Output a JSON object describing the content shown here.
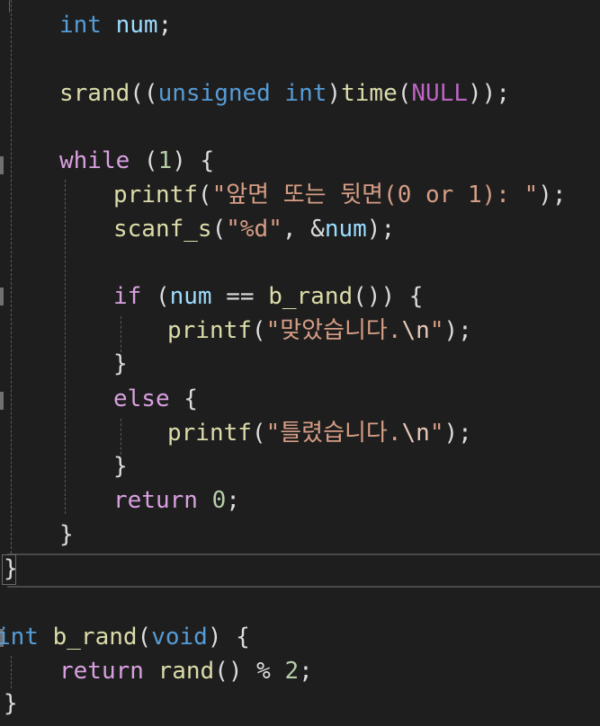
{
  "code": {
    "l1": {
      "t1": "int",
      "t2": "num",
      "t3": ";"
    },
    "l2": {
      "t1": "srand",
      "t2": "((",
      "t3": "unsigned",
      "t4": "int",
      "t5": ")",
      "t6": "time",
      "t7": "(",
      "t8": "NULL",
      "t9": "));"
    },
    "l3": {
      "t1": "while",
      "t2": " (",
      "t3": "1",
      "t4": ") {"
    },
    "l4": {
      "t1": "printf",
      "t2": "(",
      "t3": "\"앞면 또는 뒷면(0 or 1): \"",
      "t4": ");"
    },
    "l5": {
      "t1": "scanf_s",
      "t2": "(",
      "t3": "\"%d\"",
      "t4": ", &",
      "t5": "num",
      "t6": ");"
    },
    "l6": {
      "t1": "if",
      "t2": " (",
      "t3": "num",
      "t4": " == ",
      "t5": "b_rand",
      "t6": "()) {"
    },
    "l7": {
      "t1": "printf",
      "t2": "(",
      "t3": "\"맞았습니다.",
      "t4": "\\n",
      "t5": "\"",
      "t6": ");"
    },
    "l8": {
      "t1": "}"
    },
    "l9": {
      "t1": "else",
      "t2": " {"
    },
    "l10": {
      "t1": "printf",
      "t2": "(",
      "t3": "\"틀렸습니다.",
      "t4": "\\n",
      "t5": "\"",
      "t6": ");"
    },
    "l11": {
      "t1": "}"
    },
    "l12": {
      "t1": "return",
      "t2": "0",
      "t3": ";"
    },
    "l13": {
      "t1": "}"
    },
    "l14": {
      "t1": "}"
    },
    "l15": {
      "t1": "int",
      "t2": "b_rand",
      "t3": "(",
      "t4": "void",
      "t5": ") {"
    },
    "l16": {
      "t1": "return",
      "t2": "rand",
      "t3": "() % ",
      "t4": "2",
      "t5": ";"
    },
    "l17": {
      "t1": "}"
    }
  },
  "colors": {
    "background": "#1e1e1e",
    "keyword_blue": "#569cd6",
    "keyword_purple": "#d8a0df",
    "function": "#dcdcaa",
    "variable": "#9cdcfe",
    "string": "#d69d85",
    "number": "#b5cea8",
    "macro": "#bd63c5"
  }
}
